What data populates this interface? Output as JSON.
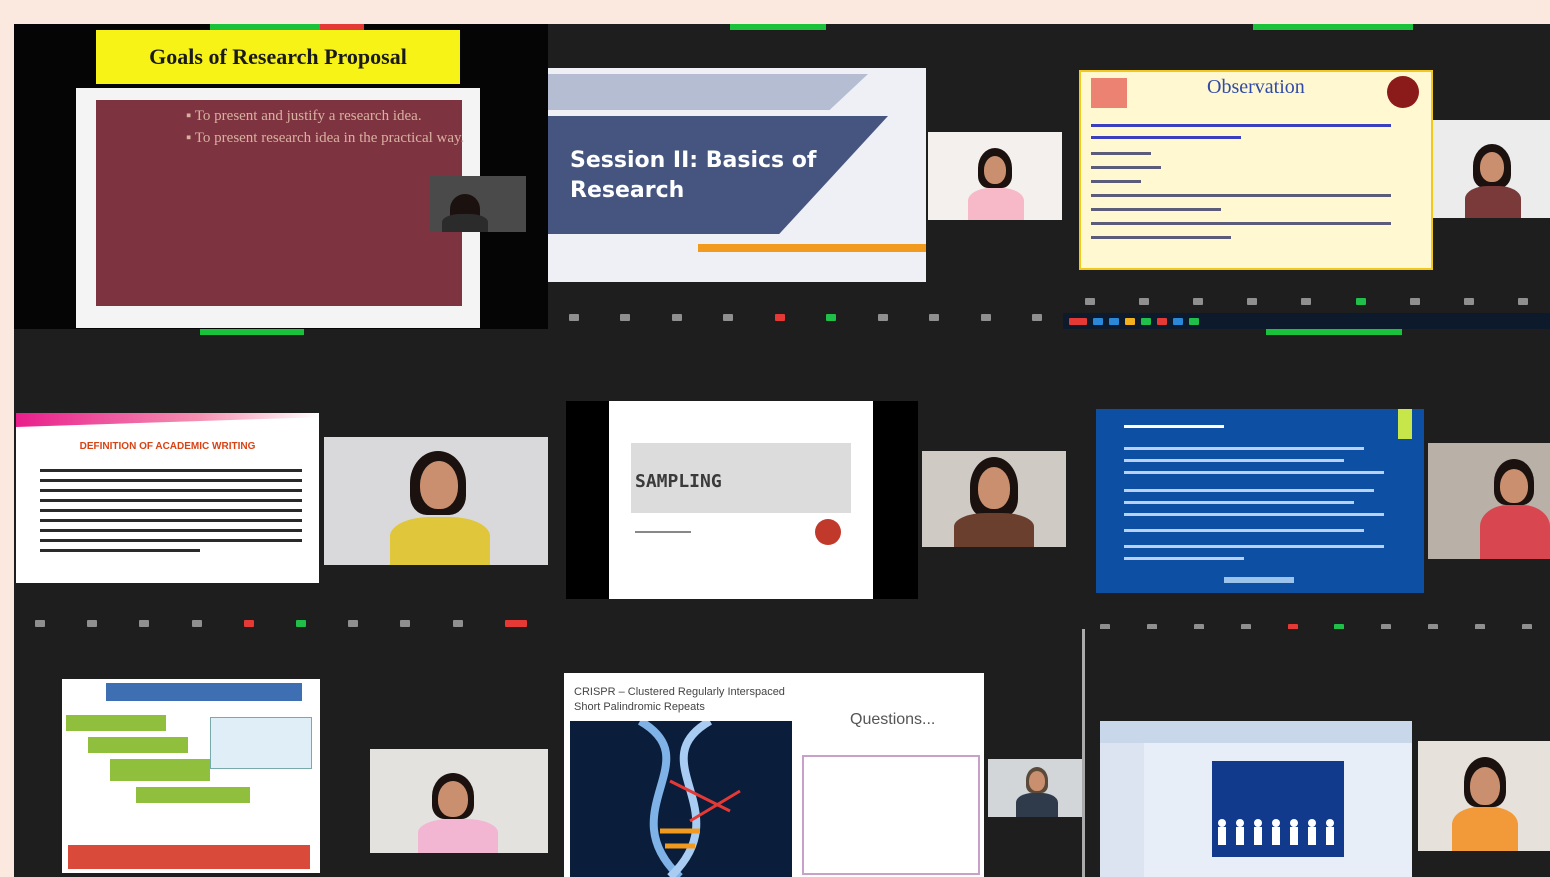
{
  "tiles": {
    "goals": {
      "title": "Goals of Research Proposal",
      "bullets": [
        "To present and justify a research idea.",
        "To present research idea in the practical way."
      ]
    },
    "session": {
      "title_line1": "Session II: Basics of",
      "title_line2": "Research"
    },
    "observation": {
      "title": "Observation"
    },
    "academic": {
      "title": "DEFINITION OF ACADEMIC WRITING"
    },
    "sampling": {
      "title": "SAMPLING"
    },
    "crispr": {
      "title_line1": "CRISPR – Clustered Regularly Interspaced",
      "title_line2": "Short Palindromic Repeats",
      "questions": "Questions..."
    }
  },
  "colors": {
    "background": "#fbe9e0",
    "tile_bg": "#1e1e1e",
    "zoom_green": "#19c23a",
    "goals_yellow": "#f7f316",
    "goals_panel": "#7e3440",
    "session_band": "#45557f",
    "session_orange": "#f29a1e",
    "observation_border": "#f3c81c",
    "questionnaire_blue": "#0d4fa3"
  },
  "icons": [
    "mic-icon",
    "video-icon",
    "security-icon",
    "participants-icon",
    "chat-icon",
    "share-screen-icon",
    "record-icon",
    "reactions-icon",
    "apps-icon",
    "more-icon",
    "end-button"
  ]
}
